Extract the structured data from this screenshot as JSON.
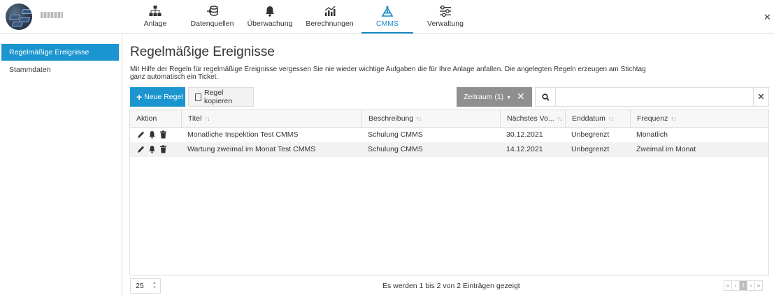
{
  "colors": {
    "accent": "#1b95cf",
    "chip": "#8f8f8f",
    "border": "#dcdcdc"
  },
  "nav": [
    {
      "label": "Anlage",
      "icon": "sitemap-icon"
    },
    {
      "label": "Datenquellen",
      "icon": "data-source-icon"
    },
    {
      "label": "Überwachung",
      "icon": "bell-icon"
    },
    {
      "label": "Berechnungen",
      "icon": "chart-icon"
    },
    {
      "label": "CMMS",
      "icon": "tools-icon",
      "active": true
    },
    {
      "label": "Verwaltung",
      "icon": "sliders-icon"
    }
  ],
  "sidebar": {
    "items": [
      {
        "label": "Regelmäßige Ereignisse",
        "active": true
      },
      {
        "label": "Stammdaten"
      }
    ]
  },
  "page": {
    "title": "Regelmäßige Ereignisse",
    "description": "Mit Hilfe der Regeln für regelmäßige Ereignisse vergessen Sie nie wieder wichtige Aufgaben die für Ihre Anlage anfallen. Die angelegten Regeln erzeugen am Stichtag ganz automatisch ein Ticket."
  },
  "toolbar": {
    "new_rule": "Neue Regel",
    "copy_rule": "Regel kopieren",
    "filter_label": "Zeitraum (1)",
    "search_placeholder": "",
    "search_value": ""
  },
  "table": {
    "columns": [
      "Aktion",
      "Titel",
      "Beschreibung",
      "Nächstes Vo...",
      "Enddatum",
      "Frequenz"
    ],
    "rows": [
      {
        "title": "Monatliche Inspektion Test CMMS",
        "description": "Schulung CMMS",
        "next": "30.12.2021",
        "end": "Unbegrenzt",
        "frequency": "Monatlich"
      },
      {
        "title": "Wartung zweimal im Monat Test CMMS",
        "description": "Schulung CMMS",
        "next": "14.12.2021",
        "end": "Unbegrenzt",
        "frequency": "Zweimal im Monat"
      }
    ]
  },
  "footer": {
    "page_size": "25",
    "info": "Es werden 1 bis 2 von 2 Einträgen gezeigt",
    "pager": {
      "first": "«",
      "prev": "‹",
      "current": "1",
      "next": "›",
      "last": "»"
    }
  }
}
